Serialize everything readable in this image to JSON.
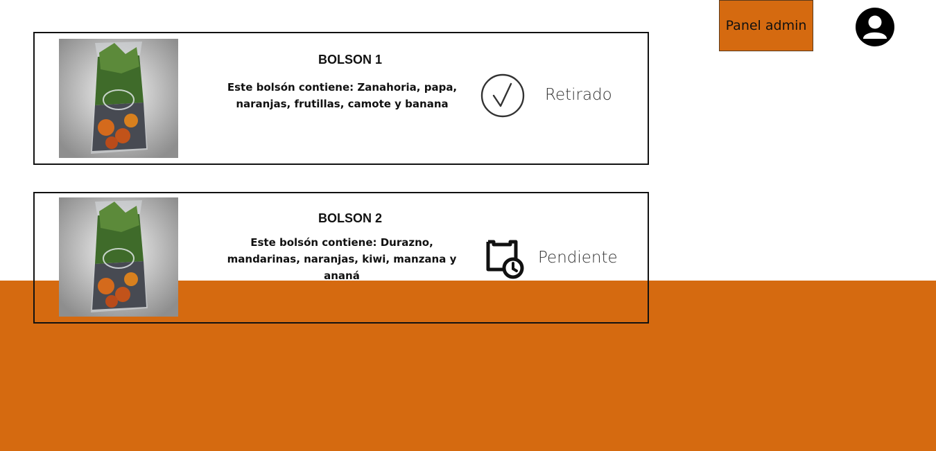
{
  "header": {
    "admin_button_label": "Panel admin",
    "avatar_icon": "user-avatar-icon"
  },
  "orders": [
    {
      "title": "BOLSON 1",
      "description": "Este bolsón contiene: Zanahoria, papa, naranjas, frutillas, camote y banana",
      "status": "Retirado",
      "status_icon": "check-circle-icon"
    },
    {
      "title": "BOLSON 2",
      "description": "Este bolsón contiene: Durazno, mandarinas, naranjas, kiwi, manzana y ananá",
      "status": "Pendiente",
      "status_icon": "clipboard-clock-icon"
    }
  ],
  "colors": {
    "accent": "#d56a10",
    "border": "#111111"
  }
}
